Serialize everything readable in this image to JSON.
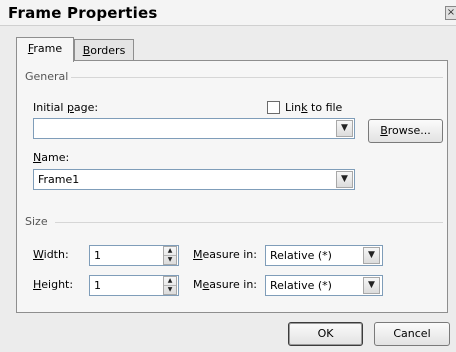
{
  "dialog": {
    "title": "Frame Properties",
    "close_icon": "close-icon",
    "close_glyph": "×"
  },
  "tabs": [
    {
      "prefix": "",
      "key": "F",
      "rest": "rame"
    },
    {
      "prefix": "",
      "key": "B",
      "rest": "orders"
    }
  ],
  "general": {
    "group_label": "General",
    "initial_page_label": {
      "prefix": "Initial ",
      "key": "p",
      "rest": "age:"
    },
    "initial_page_value": "",
    "link_checkbox": {
      "prefix": "Lin",
      "key": "k",
      "rest": " to file",
      "checked": false
    },
    "browse_button": {
      "prefix": "",
      "key": "B",
      "rest": "rowse..."
    },
    "name_label": {
      "prefix": "",
      "key": "N",
      "rest": "ame:"
    },
    "name_value": "Frame1"
  },
  "size": {
    "group_label": "Size",
    "width": {
      "label": {
        "prefix": "",
        "key": "W",
        "rest": "idth:"
      },
      "value": "1",
      "measure_label": {
        "prefix": "",
        "key": "M",
        "rest": "easure in:"
      },
      "measure_value": "Relative (*)"
    },
    "height": {
      "label": {
        "prefix": "",
        "key": "H",
        "rest": "eight:"
      },
      "value": "1",
      "measure_label": {
        "prefix": "M",
        "key": "e",
        "rest": "asure in:"
      },
      "measure_value": "Relative (*)"
    }
  },
  "footer": {
    "ok_label": "OK",
    "cancel_label": "Cancel"
  },
  "glyphs": {
    "dropdown": "▼",
    "spin_up": "▲",
    "spin_down": "▼"
  }
}
